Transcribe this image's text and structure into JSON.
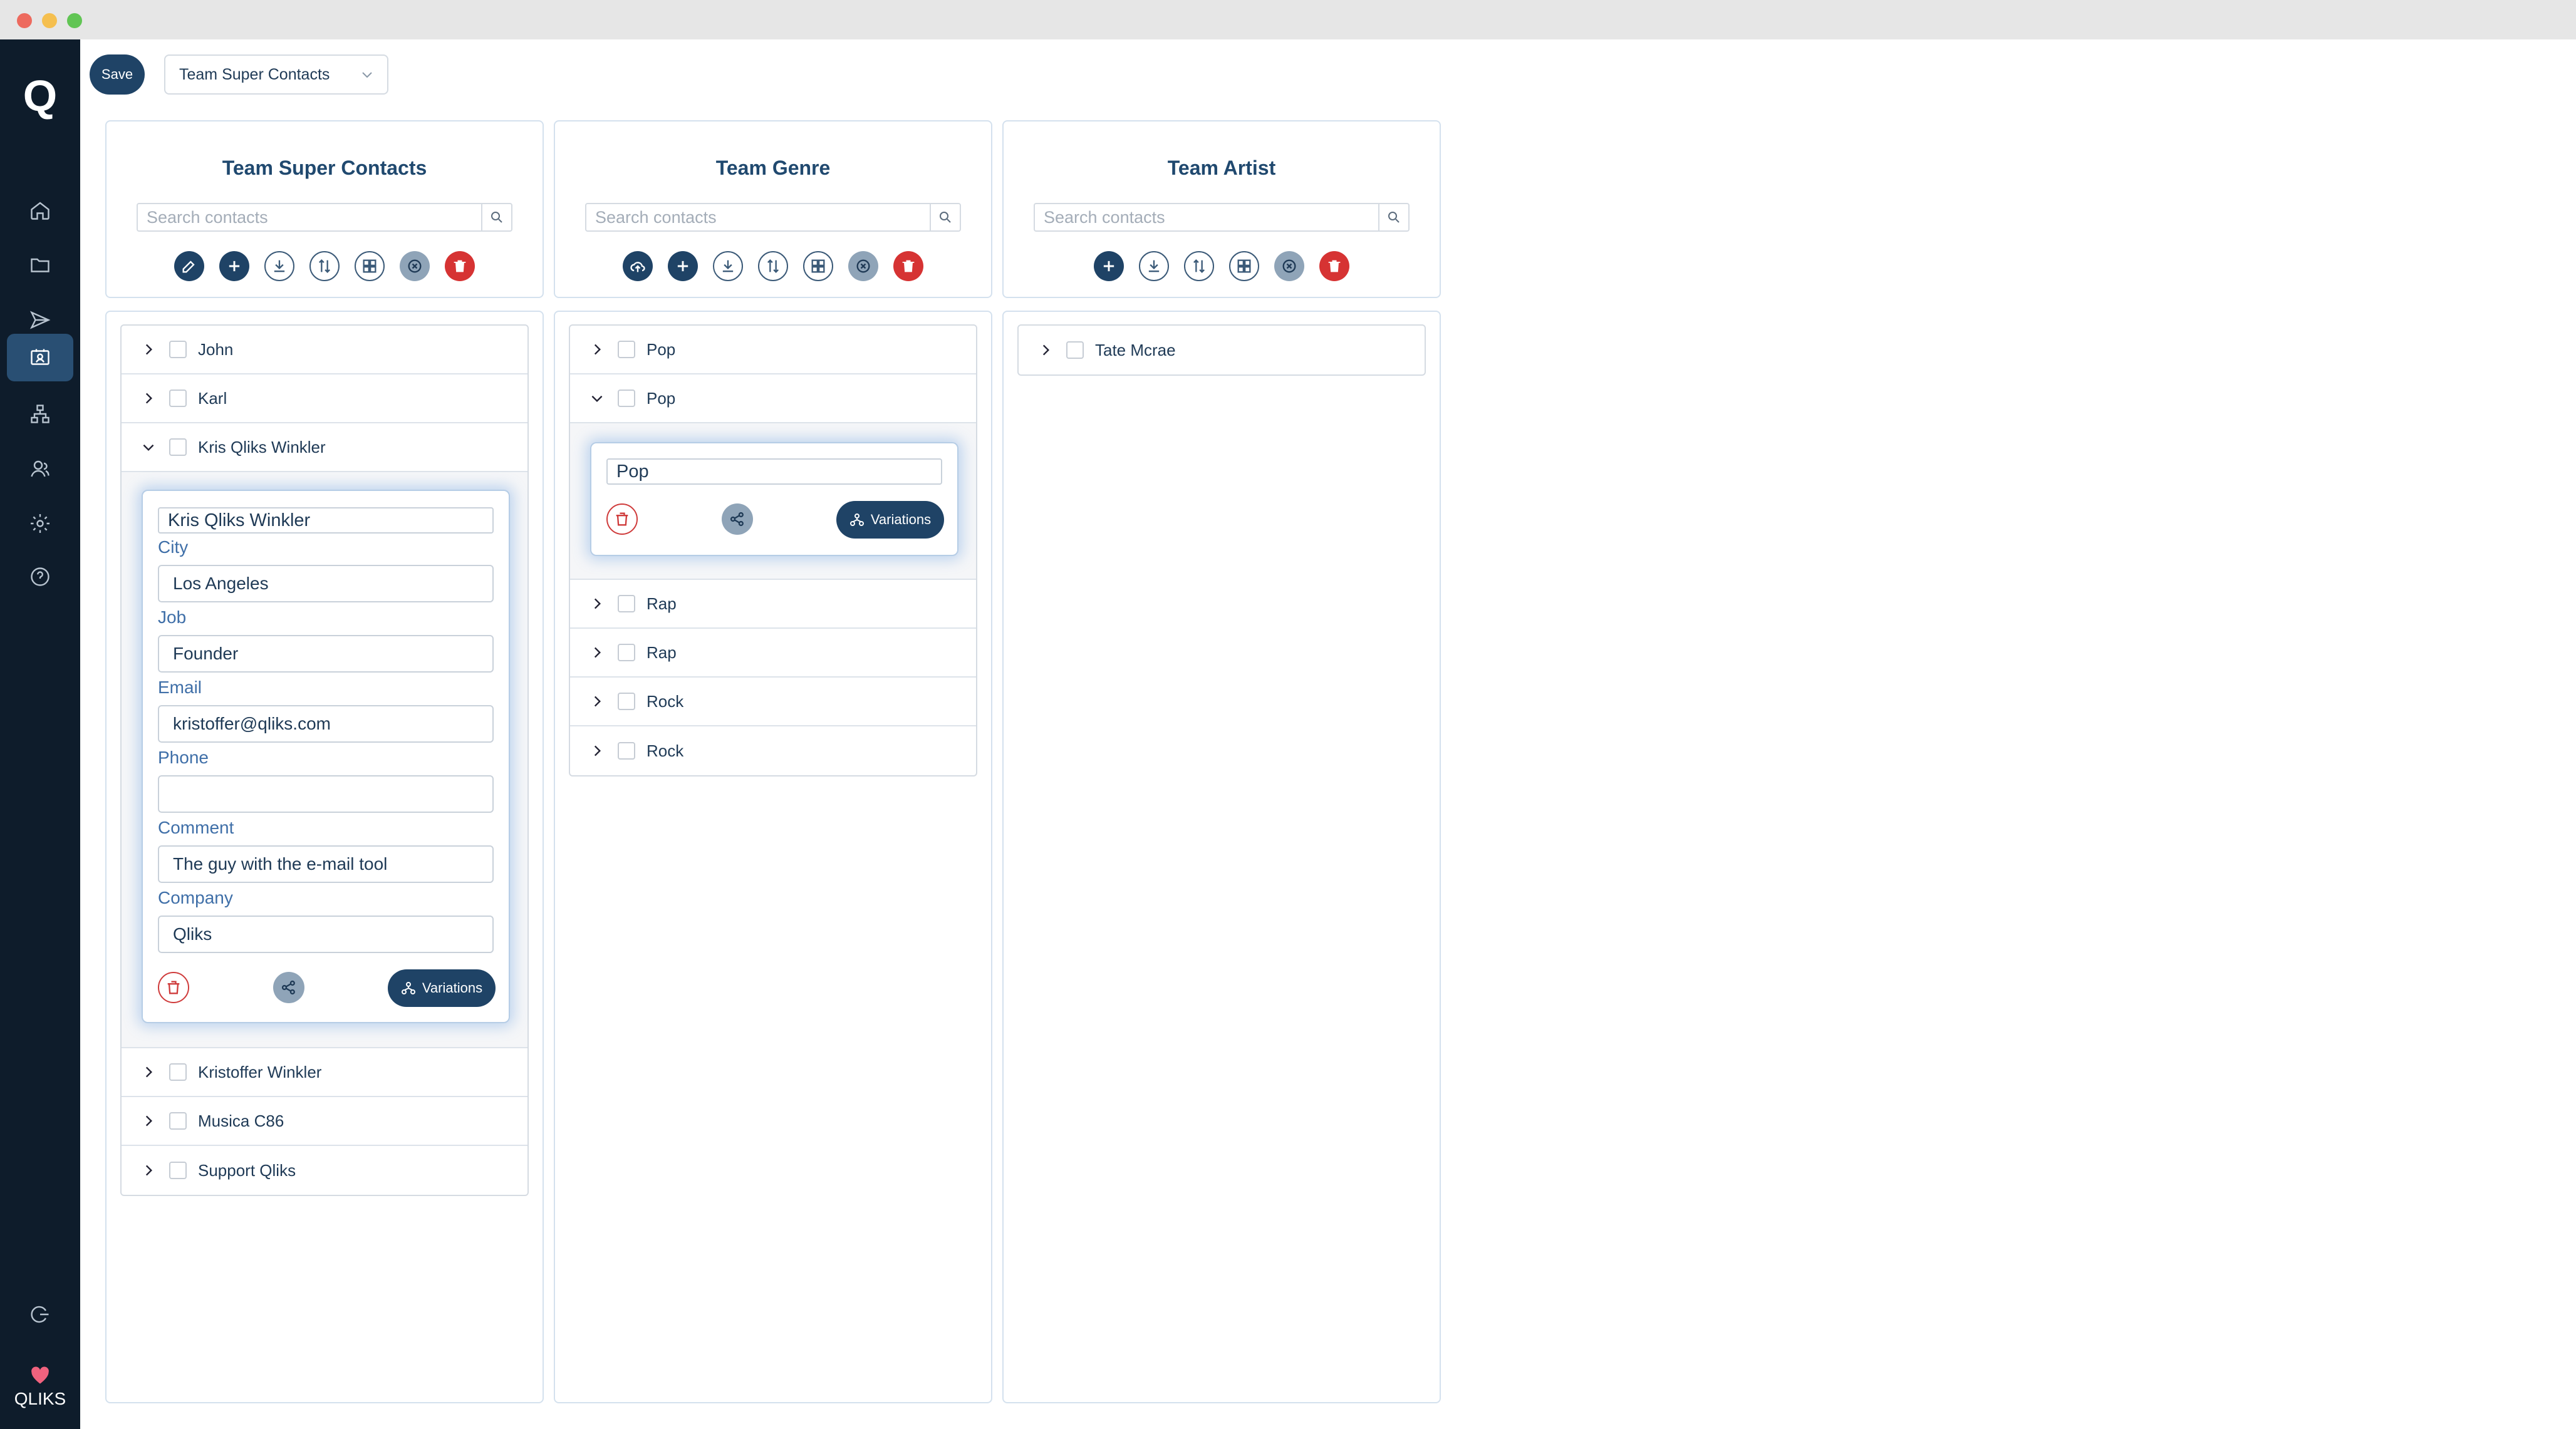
{
  "toolbar": {
    "save_label": "Save",
    "selected_team": "Team Super Contacts"
  },
  "sidebar": {
    "brand": "QLIKS",
    "items": [
      {
        "icon": "home-icon"
      },
      {
        "icon": "folder-icon"
      },
      {
        "icon": "send-icon"
      },
      {
        "icon": "contacts-icon",
        "active": true
      },
      {
        "icon": "hierarchy-icon"
      },
      {
        "icon": "users-icon"
      },
      {
        "icon": "gear-icon"
      },
      {
        "icon": "help-icon"
      }
    ]
  },
  "search_placeholder": "Search contacts",
  "columns": [
    {
      "title": "Team Super Contacts",
      "items": [
        "John",
        "Karl",
        "Kris Qliks Winkler",
        "Kristoffer Winkler",
        "Musica C86",
        "Support Qliks"
      ],
      "expanded": {
        "name": "Kris Qliks Winkler",
        "fields": [
          {
            "label": "City",
            "value": "Los Angeles"
          },
          {
            "label": "Job",
            "value": "Founder"
          },
          {
            "label": "Email",
            "value": "kristoffer@qliks.com"
          },
          {
            "label": "Phone",
            "value": ""
          },
          {
            "label": "Comment",
            "value": "The guy with the e-mail tool"
          },
          {
            "label": "Company",
            "value": "Qliks"
          }
        ],
        "variations_label": "Variations"
      }
    },
    {
      "title": "Team Genre",
      "items": [
        "Pop",
        "Pop",
        "Rap",
        "Rap",
        "Rock",
        "Rock"
      ],
      "expanded": {
        "name": "Pop",
        "variations_label": "Variations"
      }
    },
    {
      "title": "Team Artist",
      "items": [
        "Tate Mcrae"
      ]
    }
  ],
  "colors": {
    "sidebar_bg": "#0e1c2b",
    "primary": "#1f4366",
    "danger": "#d63333",
    "label_blue": "#3f6fa8"
  }
}
